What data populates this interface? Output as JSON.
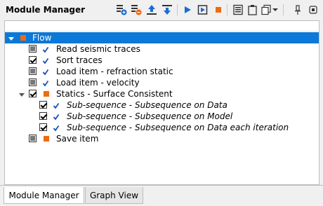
{
  "window": {
    "title": "Module Manager"
  },
  "toolbar": {
    "icons": [
      "add-module-icon",
      "remove-module-icon",
      "move-up-icon",
      "move-down-icon",
      "run-icon",
      "run-step-icon",
      "stop-icon",
      "list-icon",
      "clipboard-icon",
      "copy-icon",
      "dropdown-icon",
      "pin-icon",
      "maximize-icon"
    ],
    "colors": {
      "blue": "#1a6bd6",
      "orange": "#f06a0f",
      "dark": "#333333"
    }
  },
  "tree": {
    "root": {
      "label": "Flow",
      "square_color": "#f06a0f"
    },
    "items": [
      {
        "label": "Read seismic traces",
        "checkbox": "grey",
        "check": true,
        "square": false,
        "italic": false
      },
      {
        "label": "Sort traces",
        "checkbox": "checked",
        "check": true,
        "square": false,
        "italic": false
      },
      {
        "label": "Load item - refraction static",
        "checkbox": "grey",
        "check": true,
        "square": false,
        "italic": false
      },
      {
        "label": "Load item - velocity",
        "checkbox": "grey",
        "check": true,
        "square": false,
        "italic": false
      },
      {
        "label": "Statics - Surface Consistent",
        "checkbox": "checked",
        "check": false,
        "square": true,
        "italic": false
      },
      {
        "label": "Sub-sequence - Subsequence on Data",
        "checkbox": "checked",
        "check": true,
        "square": false,
        "italic": true
      },
      {
        "label": "Sub-sequence - Subsequence on Model",
        "checkbox": "checked",
        "check": true,
        "square": false,
        "italic": true
      },
      {
        "label": "Sub-sequence - Subsequence on Data each iteration",
        "checkbox": "checked",
        "check": true,
        "square": false,
        "italic": true
      },
      {
        "label": "Save item",
        "checkbox": "grey",
        "check": false,
        "square": true,
        "italic": false
      }
    ]
  },
  "tabs": [
    {
      "label": "Module Manager",
      "active": true
    },
    {
      "label": "Graph View",
      "active": false
    }
  ],
  "colors": {
    "selection": "#0c78d8",
    "check": "#1a4fb8",
    "square": "#f06a0f"
  }
}
